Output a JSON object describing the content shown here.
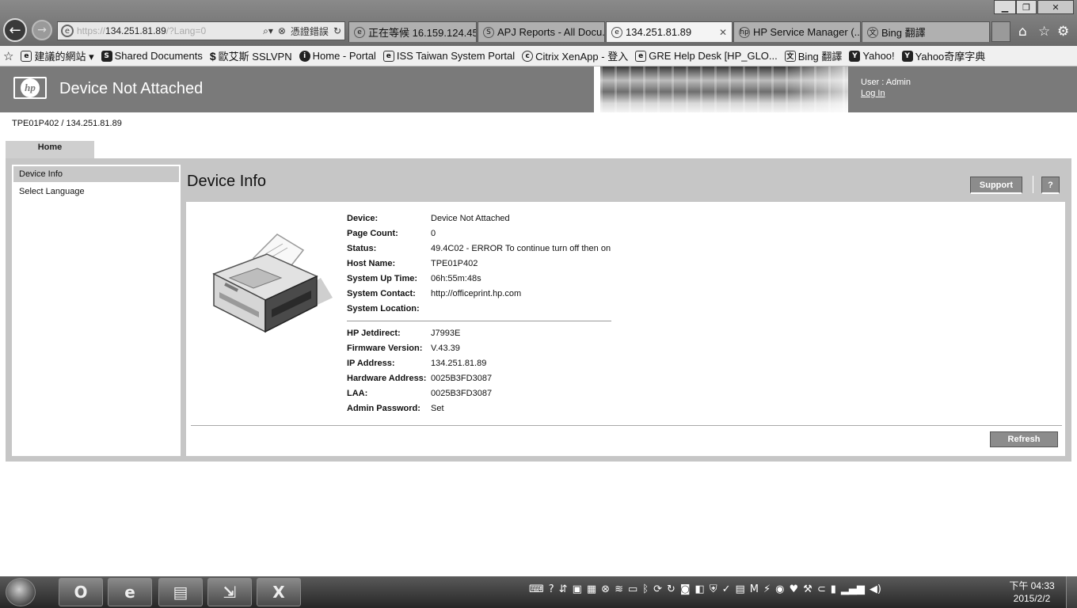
{
  "browser": {
    "address": {
      "protocol": "https://",
      "host": "134.251.81.89",
      "query": "/?Lang=0",
      "cert_error_label": "憑證錯誤"
    },
    "tabs": [
      {
        "label": "正在等候 16.159.124.45",
        "icon": "ie-page-icon"
      },
      {
        "label": "APJ Reports - All Docu...",
        "icon": "sharepoint-icon"
      },
      {
        "label": "134.251.81.89",
        "icon": "ie-page-icon",
        "active": true
      },
      {
        "label": "HP Service Manager (...",
        "icon": "hp-icon"
      },
      {
        "label": "Bing 翻譯",
        "icon": "translate-icon"
      }
    ],
    "favorites": [
      {
        "label": "建議的網站 ▾",
        "icon": "suggested-sites-icon"
      },
      {
        "label": "Shared Documents",
        "icon": "sharepoint-icon"
      },
      {
        "label": "歐艾斯 SSLVPN",
        "icon": "dollar-icon"
      },
      {
        "label": "Home - Portal",
        "icon": "iss-icon"
      },
      {
        "label": "ISS Taiwan System Portal",
        "icon": "ie-page-icon"
      },
      {
        "label": "Citrix XenApp - 登入",
        "icon": "citrix-icon"
      },
      {
        "label": "GRE Help Desk [HP_GLO...",
        "icon": "ie-page-icon"
      },
      {
        "label": "Bing 翻譯",
        "icon": "translate-icon"
      },
      {
        "label": "Yahoo!",
        "icon": "yahoo-icon"
      },
      {
        "label": "Yahoo奇摩字典",
        "icon": "yahoo-icon"
      }
    ]
  },
  "header": {
    "title": "Device Not Attached",
    "user_label": "User : Admin",
    "login_link": "Log In"
  },
  "breadcrumb": "TPE01P402 / 134.251.81.89",
  "main_tab": "Home",
  "sidebar": {
    "items": [
      {
        "label": "Device Info",
        "active": true
      },
      {
        "label": "Select Language",
        "active": false
      }
    ]
  },
  "page": {
    "title": "Device Info",
    "support_label": "Support",
    "help_label": "?",
    "refresh_label": "Refresh"
  },
  "device_info": {
    "group1": [
      {
        "key": "Device:",
        "value": "Device Not Attached"
      },
      {
        "key": "Page Count:",
        "value": "0"
      },
      {
        "key": "Status:",
        "value": "49.4C02 - ERROR To continue turn off then on"
      },
      {
        "key": "Host Name:",
        "value": "TPE01P402"
      },
      {
        "key": "System Up Time:",
        "value": "06h:55m:48s"
      },
      {
        "key": "System Contact:",
        "value": "http://officeprint.hp.com"
      },
      {
        "key": "System Location:",
        "value": ""
      }
    ],
    "group2": [
      {
        "key": "HP Jetdirect:",
        "value": "J7993E"
      },
      {
        "key": "Firmware Version:",
        "value": "V.43.39"
      },
      {
        "key": "IP Address:",
        "value": "134.251.81.89"
      },
      {
        "key": "Hardware Address:",
        "value": "0025B3FD3087"
      },
      {
        "key": "LAA:",
        "value": "0025B3FD3087"
      },
      {
        "key": "Admin Password:",
        "value": "Set"
      }
    ]
  },
  "taskbar": {
    "clock_time": "下午 04:33",
    "clock_date": "2015/2/2"
  }
}
